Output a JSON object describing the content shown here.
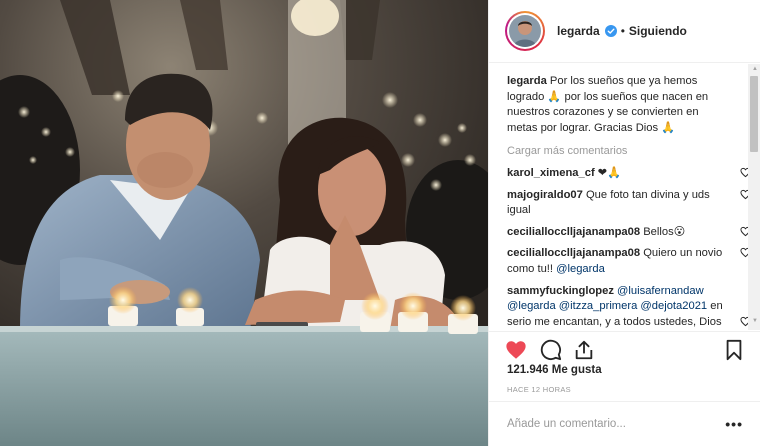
{
  "post": {
    "photo_alt": "Pareja encendiendo velas",
    "author": "legarda",
    "follow_status": "Siguiendo",
    "separator": "•",
    "caption_user": "legarda",
    "caption_text": "Por los sueños que ya hemos logrado 🙏 por los sueños que nacen en nuestros corazones y se convierten en metas por lograr. Gracias Dios 🙏",
    "load_more": "Cargar más comentarios",
    "comments": [
      {
        "user": "karol_ximena_cf",
        "text": "❤🙏"
      },
      {
        "user": "majogiraldo07",
        "text": "Que foto tan divina y uds igual"
      },
      {
        "user": "ceciliallocclljajanampa08",
        "text": "Bellos😮"
      },
      {
        "user": "ceciliallocclljajanampa08",
        "text": "Quiero un novio como tu!! ",
        "mention": "@legarda"
      },
      {
        "user": "sammyfuckinglopez",
        "mentions": [
          "@luisafernandaw",
          "@legarda",
          "@itzza_primera",
          "@dejota2021"
        ],
        "text": "en serio me encantan, y a todos ustedes, Dios los bendiga en"
      }
    ],
    "likes": "121.946 Me gusta",
    "time": "HACE 12 HORAS",
    "add_comment_placeholder": "Añade un comentario...",
    "more_label": "•••"
  },
  "colors": {
    "like_red": "#ed4956",
    "verified_blue": "#3897f0",
    "mention_blue": "#003569",
    "text": "#262626",
    "muted": "#999999"
  },
  "icons": [
    "verified-badge-icon",
    "heart-icon",
    "comment-icon",
    "share-icon",
    "bookmark-icon",
    "comment-like-icon"
  ]
}
